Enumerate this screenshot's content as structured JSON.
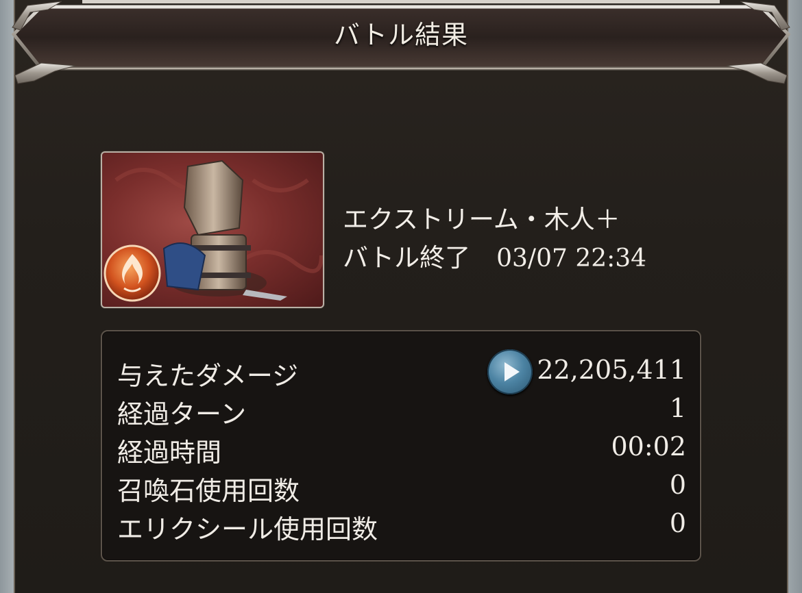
{
  "header": {
    "title": "バトル結果"
  },
  "battle": {
    "enemy_name": "エクストリーム・木人＋",
    "status_label": "バトル終了",
    "datetime": "03/07 22:34",
    "element_icon": "fire-element-icon"
  },
  "stats": {
    "rows": [
      {
        "label": "与えたダメージ",
        "value": "22,205,411"
      },
      {
        "label": "経過ターン",
        "value": "1"
      },
      {
        "label": "経過時間",
        "value": "00:02"
      },
      {
        "label": "召喚石使用回数",
        "value": "0"
      },
      {
        "label": "エリクシール使用回数",
        "value": "0"
      }
    ],
    "detail_button_icon": "play-icon"
  },
  "colors": {
    "panel_bg": "#231f1b",
    "text": "#f0ece6",
    "accent_blue": "#4c83a3",
    "thumb_red": "#7a2e2c"
  }
}
